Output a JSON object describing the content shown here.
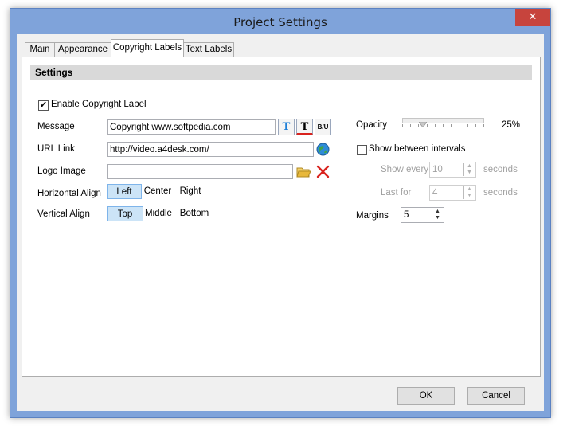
{
  "window": {
    "title": "Project Settings",
    "close_glyph": "✕"
  },
  "tabs": [
    {
      "label": "Main"
    },
    {
      "label": "Appearance"
    },
    {
      "label": "Copyright Labels"
    },
    {
      "label": "Text Labels"
    }
  ],
  "settings": {
    "header": "Settings",
    "enable_label": "Enable Copyright Label",
    "enable_checked": true,
    "message_label": "Message",
    "message_value": "Copyright www.softpedia.com",
    "url_label": "URL Link",
    "url_value": "http://video.a4desk.com/",
    "logo_label": "Logo Image",
    "logo_value": "",
    "halign_label": "Horizontal Align",
    "halign_options": [
      "Left",
      "Center",
      "Right"
    ],
    "halign_selected": "Left",
    "valign_label": "Vertical Align",
    "valign_options": [
      "Top",
      "Middle",
      "Bottom"
    ],
    "valign_selected": "Top",
    "icons": {
      "font": "T",
      "color": "T",
      "style": "B/U",
      "globe": "globe-icon",
      "folder": "folder-open-icon",
      "delete": "delete-x-icon"
    },
    "colors": {
      "accent_blue": "#1e7fd8",
      "delete_red": "#d9231e",
      "folder_yellow": "#e8b83b"
    }
  },
  "right": {
    "opacity_label": "Opacity",
    "opacity_value": "25%",
    "opacity_fraction": 0.25,
    "intervals_label": "Show between intervals",
    "intervals_checked": false,
    "show_every_label": "Show every",
    "show_every_value": "10",
    "show_every_unit": "seconds",
    "last_for_label": "Last for",
    "last_for_value": "4",
    "last_for_unit": "seconds",
    "margins_label": "Margins",
    "margins_value": "5",
    "spin_up": "▲",
    "spin_down": "▼"
  },
  "footer": {
    "ok_label": "OK",
    "cancel_label": "Cancel"
  }
}
